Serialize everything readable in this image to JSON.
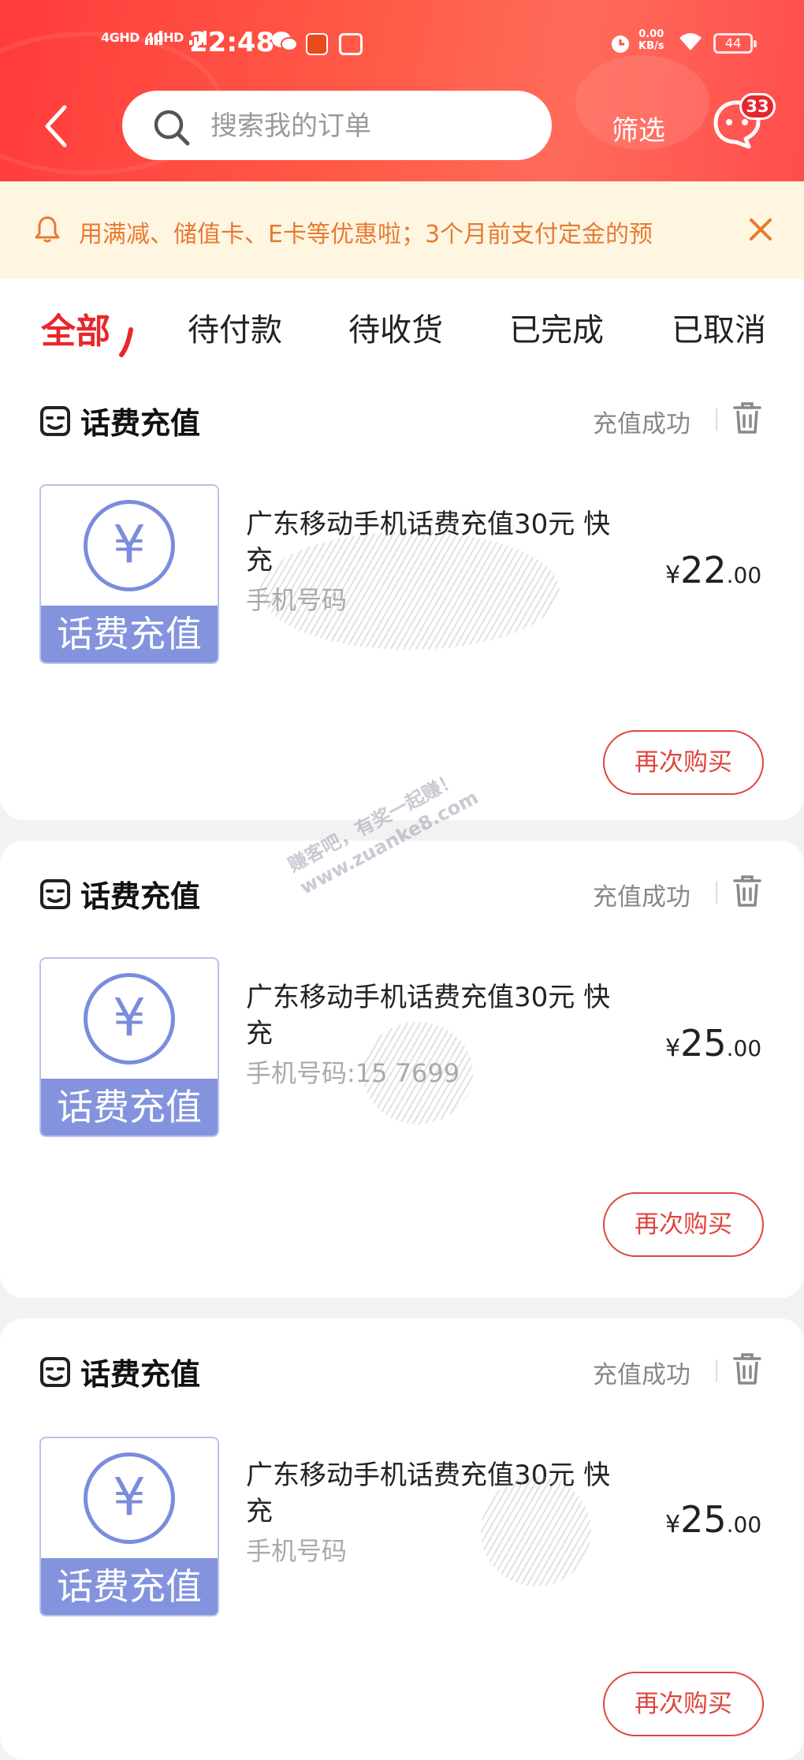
{
  "status_bar": {
    "signal1": "4GHD",
    "signal2": "4GHD",
    "time": "22:48",
    "net_speed_value": "0.00",
    "net_speed_unit": "KB/s",
    "battery": "44"
  },
  "header": {
    "search_placeholder": "搜索我的订单",
    "filter_label": "筛选",
    "message_badge": "33"
  },
  "notice": {
    "text": "用满减、储值卡、E卡等优惠啦；3个月前支付定金的预"
  },
  "tabs": [
    {
      "label": "全部",
      "active": true
    },
    {
      "label": "待付款",
      "active": false
    },
    {
      "label": "待收货",
      "active": false
    },
    {
      "label": "已完成",
      "active": false
    },
    {
      "label": "已取消",
      "active": false
    }
  ],
  "orders": [
    {
      "category": "话费充值",
      "status": "充值成功",
      "thumb_symbol": "¥",
      "thumb_label": "话费充值",
      "title": "广东移动手机话费充值30元 快充",
      "phone": "手机号码",
      "price_symbol": "¥",
      "price_int": "22",
      "price_dec": ".00",
      "rebuy_label": "再次购买"
    },
    {
      "category": "话费充值",
      "status": "充值成功",
      "thumb_symbol": "¥",
      "thumb_label": "话费充值",
      "title": "广东移动手机话费充值30元 快充",
      "phone": "手机号码:15  7699",
      "price_symbol": "¥",
      "price_int": "25",
      "price_dec": ".00",
      "rebuy_label": "再次购买"
    },
    {
      "category": "话费充值",
      "status": "充值成功",
      "thumb_symbol": "¥",
      "thumb_label": "话费充值",
      "title": "广东移动手机话费充值30元 快充",
      "phone": "手机号码",
      "price_symbol": "¥",
      "price_int": "25",
      "price_dec": ".00",
      "rebuy_label": "再次购买"
    }
  ],
  "watermark": {
    "line1": "赚客吧，有奖一起赚！",
    "line2": "www.zuanke8.com"
  },
  "colors": {
    "header_red": "#ff4d4d",
    "accent_red": "#e8272b",
    "notice_bg": "#fff6e2",
    "notice_text": "#e87a32",
    "thumb_blue": "#8393dd"
  }
}
